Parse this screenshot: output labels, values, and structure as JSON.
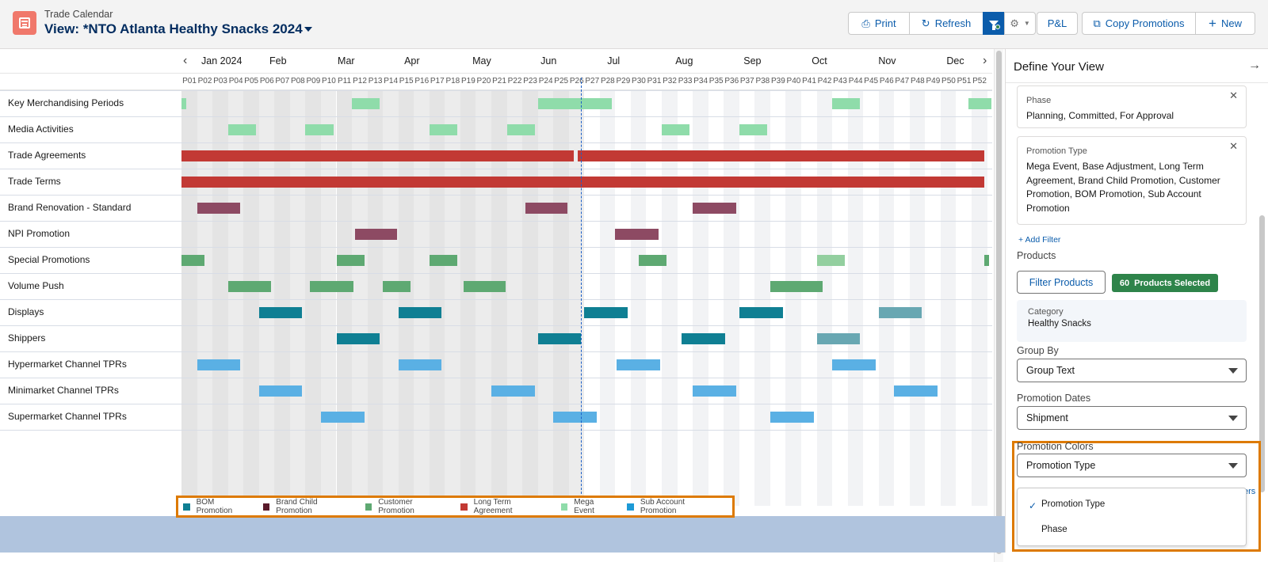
{
  "header": {
    "subtitle": "Trade Calendar",
    "title": "View: *NTO Atlanta Healthy Snacks 2024",
    "buttons": {
      "print": "Print",
      "refresh": "Refresh",
      "pl": "P&L",
      "copy": "Copy Promotions",
      "new": "New"
    }
  },
  "calendar": {
    "months": [
      "Jan 2024",
      "Feb",
      "Mar",
      "Apr",
      "May",
      "Jun",
      "Jul",
      "Aug",
      "Sep",
      "Oct",
      "Nov",
      "Dec"
    ],
    "periods": [
      "P01",
      "P02",
      "P03",
      "P04",
      "P05",
      "P06",
      "P07",
      "P08",
      "P09",
      "P10",
      "P11",
      "P12",
      "P13",
      "P14",
      "P15",
      "P16",
      "P17",
      "P18",
      "P19",
      "P20",
      "P21",
      "P22",
      "P23",
      "P24",
      "P25",
      "P26",
      "P27",
      "P28",
      "P29",
      "P30",
      "P31",
      "P32",
      "P33",
      "P34",
      "P35",
      "P36",
      "P37",
      "P38",
      "P39",
      "P40",
      "P41",
      "P42",
      "P43",
      "P44",
      "P45",
      "P46",
      "P47",
      "P48",
      "P49",
      "P50",
      "P51",
      "P52"
    ],
    "today_period_index": 25.5,
    "past_period_count": 25.5,
    "rows": [
      {
        "label": "Key Merchandising Periods",
        "bars": [
          [
            0,
            0.3,
            "mega"
          ],
          [
            11,
            1.8,
            "mega"
          ],
          [
            23,
            4.8,
            "mega"
          ],
          [
            42,
            1.8,
            "mega"
          ],
          [
            50.8,
            1.5,
            "mega"
          ]
        ]
      },
      {
        "label": "Media Activities",
        "bars": [
          [
            3,
            1.8,
            "mega"
          ],
          [
            8,
            1.8,
            "mega"
          ],
          [
            16,
            1.8,
            "mega"
          ],
          [
            21,
            1.8,
            "mega"
          ],
          [
            31,
            1.8,
            "mega"
          ],
          [
            36,
            1.8,
            "mega"
          ]
        ]
      },
      {
        "label": "Trade Agreements",
        "bars": [
          [
            0,
            25.3,
            "ltagree"
          ],
          [
            25.6,
            26.2,
            "ltagree"
          ]
        ]
      },
      {
        "label": "Trade Terms",
        "bars": [
          [
            0,
            51.8,
            "ltagree"
          ]
        ]
      },
      {
        "label": "Brand Renovation - Standard",
        "bars": [
          [
            1,
            2.8,
            "brandchild"
          ],
          [
            22.2,
            2.7,
            "brandchild"
          ],
          [
            33,
            2.8,
            "brandchild"
          ]
        ]
      },
      {
        "label": "NPI Promotion",
        "bars": [
          [
            11.2,
            2.7,
            "brandchild"
          ],
          [
            28,
            2.8,
            "brandchild"
          ]
        ]
      },
      {
        "label": "Special Promotions",
        "bars": [
          [
            0,
            1.5,
            "customer"
          ],
          [
            10,
            1.8,
            "customer"
          ],
          [
            16,
            1.8,
            "customer"
          ],
          [
            29.5,
            1.8,
            "customer"
          ],
          [
            41,
            1.8,
            "customer-light"
          ],
          [
            51.8,
            0.3,
            "customer"
          ]
        ]
      },
      {
        "label": "Volume Push",
        "bars": [
          [
            3,
            2.8,
            "customer"
          ],
          [
            8.3,
            2.8,
            "customer"
          ],
          [
            13,
            1.8,
            "customer"
          ],
          [
            18.2,
            2.7,
            "customer"
          ],
          [
            38,
            3.4,
            "customer"
          ]
        ]
      },
      {
        "label": "Displays",
        "bars": [
          [
            5,
            2.8,
            "bom"
          ],
          [
            14,
            2.8,
            "bom"
          ],
          [
            26,
            2.8,
            "bom"
          ],
          [
            36,
            2.8,
            "bom"
          ],
          [
            45,
            2.8,
            "bom-light"
          ]
        ]
      },
      {
        "label": "Shippers",
        "bars": [
          [
            10,
            2.8,
            "bom"
          ],
          [
            23,
            2.8,
            "bom"
          ],
          [
            32.3,
            2.8,
            "bom"
          ],
          [
            41,
            2.8,
            "bom-light"
          ]
        ]
      },
      {
        "label": "Hypermarket Channel TPRs",
        "bars": [
          [
            1,
            2.8,
            "subacct"
          ],
          [
            14,
            2.8,
            "subacct"
          ],
          [
            28.1,
            2.8,
            "subacct"
          ],
          [
            42,
            2.8,
            "subacct"
          ]
        ]
      },
      {
        "label": "Minimarket Channel TPRs",
        "bars": [
          [
            5,
            2.8,
            "subacct"
          ],
          [
            20,
            2.8,
            "subacct"
          ],
          [
            33,
            2.8,
            "subacct"
          ],
          [
            46,
            2.8,
            "subacct"
          ]
        ]
      },
      {
        "label": "Supermarket Channel TPRs",
        "bars": [
          [
            9,
            2.8,
            "subacct"
          ],
          [
            24,
            2.8,
            "subacct"
          ],
          [
            38,
            2.8,
            "subacct"
          ]
        ]
      }
    ],
    "colors": {
      "mega": "#8fdcaa",
      "ltagree": "#c23934",
      "brandchild": "#8d4a63",
      "customer": "#5ea972",
      "customer-light": "#93cf9f",
      "bom": "#0f7f93",
      "bom-light": "#68a7b2",
      "subacct": "#5ab0e4"
    },
    "legend": [
      {
        "label": "BOM Promotion",
        "color": "#0f7f93"
      },
      {
        "label": "Brand Child Promotion",
        "color": "#5a1a2b"
      },
      {
        "label": "Customer Promotion",
        "color": "#5ea972"
      },
      {
        "label": "Long Term Agreement",
        "color": "#c23934"
      },
      {
        "label": "Mega Event",
        "color": "#8fdcaa"
      },
      {
        "label": "Sub Account Promotion",
        "color": "#1d9ad6"
      }
    ]
  },
  "panel": {
    "title": "Define Your View",
    "filters": [
      {
        "label": "Phase",
        "value": "Planning, Committed, For Approval"
      },
      {
        "label": "Promotion Type",
        "value": "Mega Event, Base Adjustment, Long Term Agreement, Brand Child Promotion, Customer Promotion, BOM Promotion, Sub Account Promotion"
      }
    ],
    "add_filter": "+ Add Filter",
    "products_label": "Products",
    "filter_products": "Filter Products",
    "products_count": "60",
    "products_selected": "Products Selected",
    "category_label": "Category",
    "category_value": "Healthy Snacks",
    "group_by_label": "Group By",
    "group_by_value": "Group Text",
    "dates_label": "Promotion Dates",
    "dates_value": "Shipment",
    "colors_label": "Promotion Colors",
    "colors_value": "Promotion Type",
    "color_options": [
      "Promotion Type",
      "Phase"
    ],
    "hidden_link_fragment": "ers"
  }
}
